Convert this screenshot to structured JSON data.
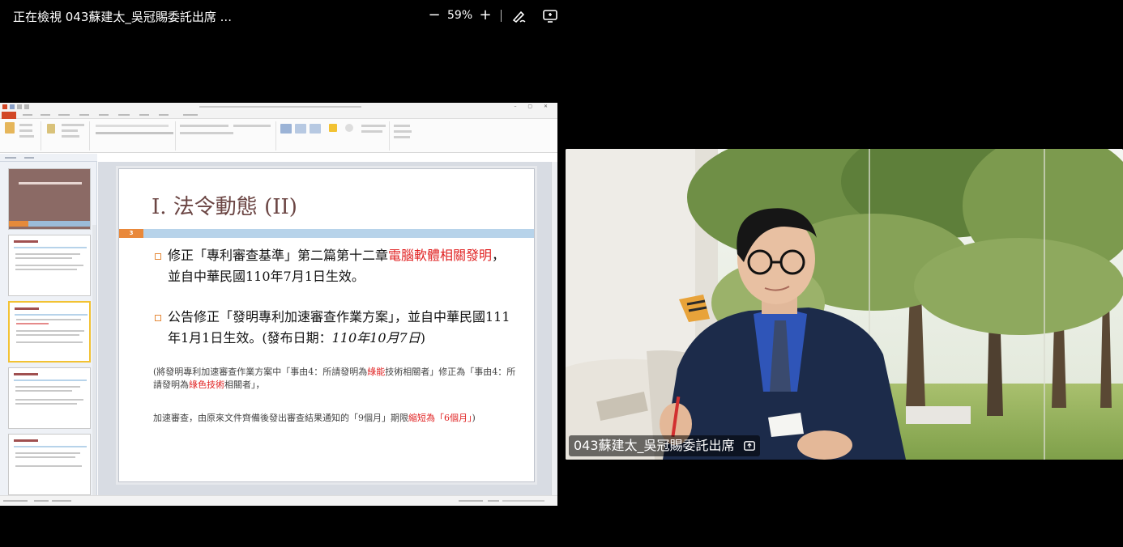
{
  "viewer": {
    "title": "正在檢視 043蘇建太_吳冠賜委託出席 ...",
    "zoom_out": "−",
    "zoom_level": "59%",
    "zoom_in": "+"
  },
  "icons": {
    "annotate": "annotate-pen-icon",
    "view_options": "view-options-icon",
    "share": "screen-share-icon"
  },
  "slide": {
    "title": "I. 法令動態 (II)",
    "number": "3",
    "bullet1_a": "修正「專利審查基準」第二篇第十二章",
    "bullet1_red": "電腦軟體相關發明",
    "bullet1_b": "，並自中華民國110年7月1日生效。",
    "bullet2_a": "公告修正「發明專利加速審查作業方案」，並自中華民國111年1月1日生效。(發布日期：",
    "bullet2_italic": "110年10月7日",
    "bullet2_b": ")",
    "note1_a": "(將發明專利加速審查作業方案中「事由4：所請發明為",
    "note1_red1": "綠能",
    "note1_b": "技術相關者」修正為「事由4：所請發明為",
    "note1_red2": "綠色技術",
    "note1_c": "相關者」，",
    "note2_a": "加速審查，由原來文件齊備後發出審查結果通知的「9個月」期限",
    "note2_red1": "縮短為「6個月」",
    "note2_b": ")"
  },
  "video": {
    "participant_name": "043蘇建太_吳冠賜委託出席"
  },
  "colors": {
    "slide_title": "#6b4543",
    "accent_orange": "#e9883a",
    "band_blue": "#b7d3ea",
    "highlight_red": "#e02020",
    "ppt_file_tab": "#d24726"
  }
}
